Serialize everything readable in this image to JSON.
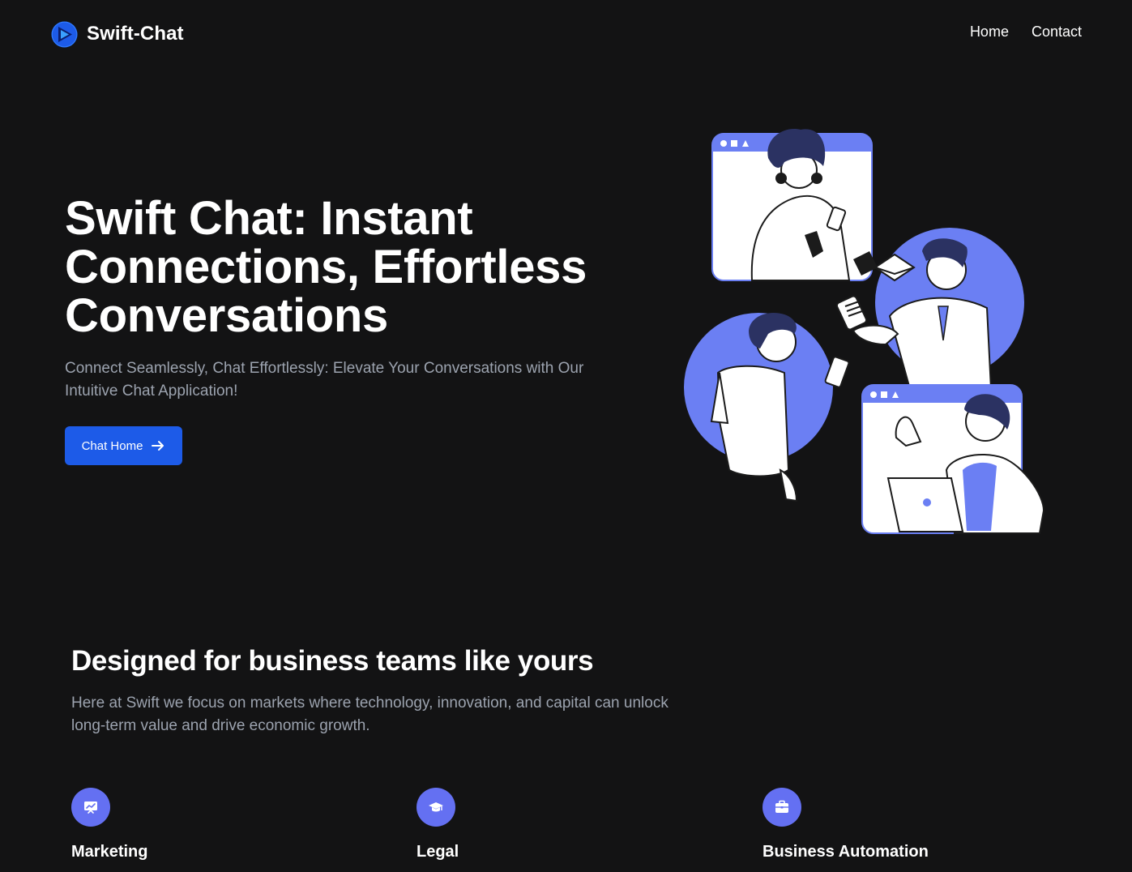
{
  "colors": {
    "background": "#131314",
    "accent_blue": "#1d5be8",
    "illustration_accent": "#6b7ff3",
    "feature_icon_bg": "#6470f2",
    "muted_text": "#9ca3af"
  },
  "navbar": {
    "brand_name": "Swift-Chat",
    "brand_icon": "swift-chat-logo-icon",
    "links": [
      {
        "label": "Home"
      },
      {
        "label": "Contact"
      }
    ]
  },
  "hero": {
    "title": "Swift Chat: Instant Connections, Effortless Conversations",
    "subtitle": "Connect Seamlessly, Chat Effortlessly: Elevate Your Conversations with Our Intuitive Chat Application!",
    "cta": {
      "label": "Chat Home",
      "icon": "arrow-right-icon"
    },
    "illustration": "people-chatting-illustration"
  },
  "features_section": {
    "title": "Designed for business teams like yours",
    "subtitle": "Here at Swift we focus on markets where technology, innovation, and capital can unlock long-term value and drive economic growth.",
    "features": [
      {
        "title": "Marketing",
        "icon": "presentation-chart-icon"
      },
      {
        "title": "Legal",
        "icon": "graduation-cap-icon"
      },
      {
        "title": "Business Automation",
        "icon": "briefcase-icon"
      }
    ]
  }
}
